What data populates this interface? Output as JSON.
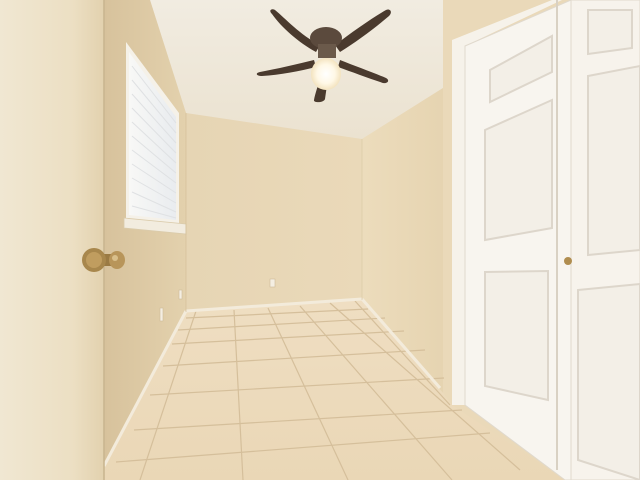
{
  "scene": {
    "kind": "photo",
    "subject": "empty bedroom",
    "palette": {
      "wall_light": "#efe3c9",
      "wall_mid": "#e3d3b4",
      "wall_shadow": "#d2bd97",
      "ceiling": "#f3eee2",
      "tile": "#eedcbf",
      "grout": "#d7c29f",
      "door_white": "#f7f3ec",
      "door_panel_shadow": "#ddd6cb",
      "fan_blade": "#4a3a2e",
      "brass": "#b08d4f"
    }
  }
}
